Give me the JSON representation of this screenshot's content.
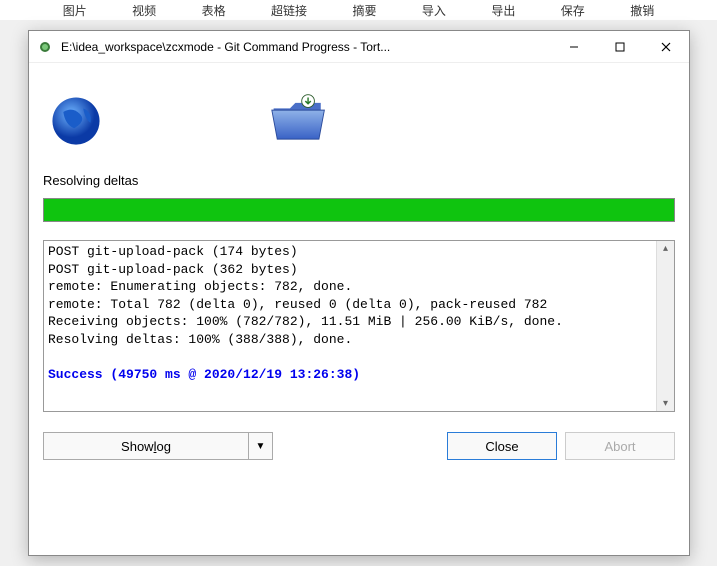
{
  "bg_toolbar": {
    "items": [
      "图片",
      "视频",
      "表格",
      "超链接",
      "摘要",
      "导入",
      "导出",
      "保存",
      "撤销"
    ]
  },
  "titlebar": {
    "title": "E:\\idea_workspace\\zcxmode - Git Command Progress - Tort..."
  },
  "status": {
    "label": "Resolving deltas"
  },
  "log": {
    "lines": [
      "POST git-upload-pack (174 bytes)",
      "POST git-upload-pack (362 bytes)",
      "remote: Enumerating objects: 782, done.",
      "remote: Total 782 (delta 0), reused 0 (delta 0), pack-reused 782",
      "Receiving objects: 100% (782/782), 11.51 MiB | 256.00 KiB/s, done.",
      "Resolving deltas: 100% (388/388), done."
    ],
    "success": "Success (49750 ms @ 2020/12/19 13:26:38)"
  },
  "buttons": {
    "show_log_prefix": "Show ",
    "show_log_ul": "l",
    "show_log_suffix": "og",
    "close": "Close",
    "abort": "Abort"
  }
}
